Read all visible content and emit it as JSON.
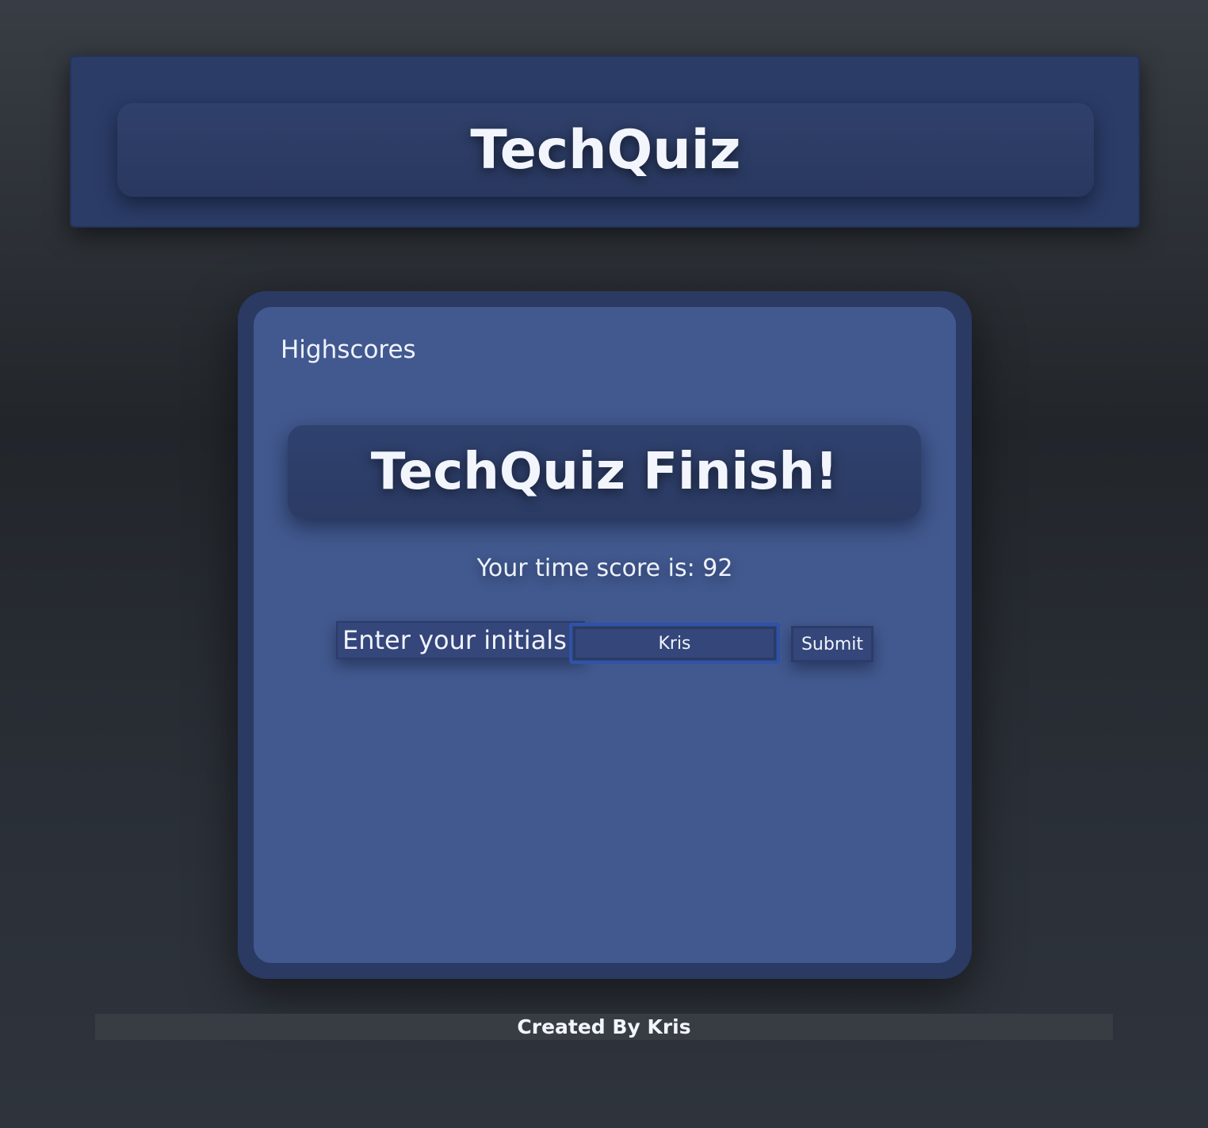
{
  "header": {
    "title": "TechQuiz"
  },
  "card": {
    "highscores_link": "Highscores",
    "finish_title": "TechQuiz Finish!",
    "score_text": "Your time score is: 92",
    "form": {
      "label": "Enter your initials:",
      "input_value": "Kris",
      "submit_label": "Submit"
    }
  },
  "footer": {
    "text": "Created By Kris"
  },
  "colors": {
    "header_bg": "#2b3c67",
    "card_bg": "#42598f",
    "accent_border": "#2e53a8",
    "text": "#eef2fb"
  }
}
